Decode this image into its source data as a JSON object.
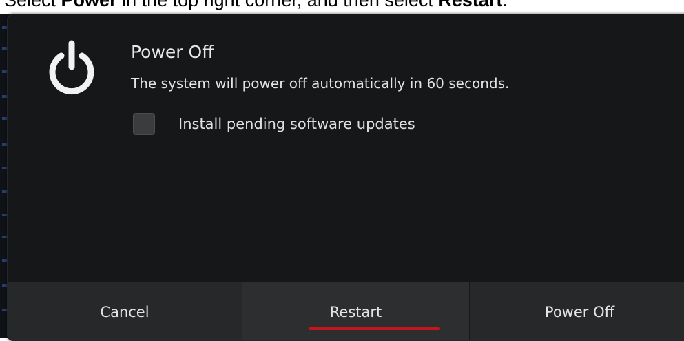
{
  "instruction": {
    "prefix": "Select ",
    "bold1": "Power",
    "middle": " in the top right corner, and then select ",
    "bold2": "Restart",
    "suffix": "."
  },
  "dialog": {
    "icon": "power-icon",
    "title": "Power Off",
    "message": "The system will power off automatically in 60 seconds.",
    "checkbox_label": "Install pending software updates",
    "checkbox_checked": false
  },
  "buttons": {
    "cancel": "Cancel",
    "restart": "Restart",
    "power_off": "Power Off"
  },
  "colors": {
    "dialog_bg": "#161718",
    "button_bg": "#262829",
    "highlight_underline": "#c4161c",
    "text": "#e4e4e4"
  }
}
